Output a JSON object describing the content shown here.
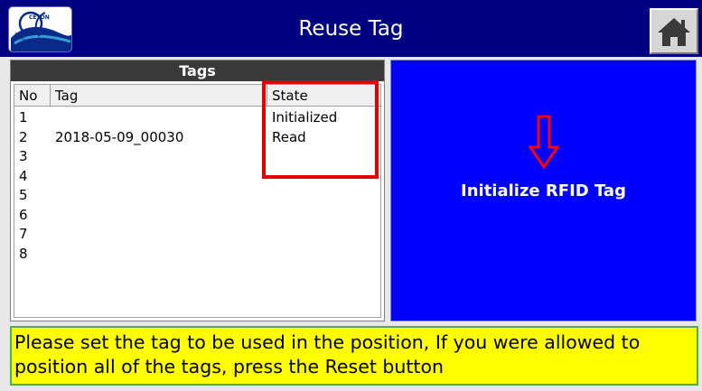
{
  "header": {
    "title": "Reuse Tag",
    "logo_text": "CEYON TECHNOLOGY",
    "home_icon": "home-icon"
  },
  "tags_panel": {
    "title": "Tags",
    "columns": [
      "No",
      "Tag",
      "State"
    ],
    "rows": [
      {
        "no": "1",
        "tag": "",
        "state": "Initialized"
      },
      {
        "no": "2",
        "tag": "2018-05-09_00030",
        "state": "Read"
      },
      {
        "no": "3",
        "tag": "",
        "state": ""
      },
      {
        "no": "4",
        "tag": "",
        "state": ""
      },
      {
        "no": "5",
        "tag": "",
        "state": ""
      },
      {
        "no": "6",
        "tag": "",
        "state": ""
      },
      {
        "no": "7",
        "tag": "",
        "state": ""
      },
      {
        "no": "8",
        "tag": "",
        "state": ""
      }
    ]
  },
  "action_panel": {
    "label": "Initialize RFID Tag",
    "icon": "down-arrow-icon"
  },
  "message": {
    "text": "Please set the tag to be used in the position, If you were allowed to position all of the tags, press the Reset button"
  },
  "colors": {
    "header_bg": "#000080",
    "action_bg": "#0000ff",
    "message_bg": "#ffff00",
    "highlight": "#e00000",
    "arrow": "#ff0000"
  }
}
